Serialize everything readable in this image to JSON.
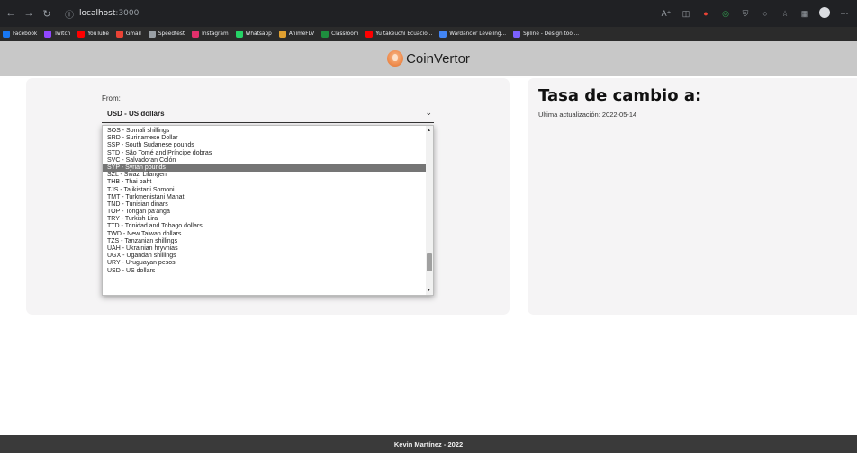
{
  "browser": {
    "url_host": "localhost",
    "url_port": ":3000",
    "bookmarks": [
      {
        "label": "Facebook",
        "color": "#1877f2"
      },
      {
        "label": "Twitch",
        "color": "#9146ff"
      },
      {
        "label": "YouTube",
        "color": "#ff0000"
      },
      {
        "label": "Gmail",
        "color": "#ea4335"
      },
      {
        "label": "Speedtest",
        "color": "#9aa0a6"
      },
      {
        "label": "Instagram",
        "color": "#e1306c"
      },
      {
        "label": "Whatsapp",
        "color": "#25d366"
      },
      {
        "label": "AnimeFLV",
        "color": "#e0a030"
      },
      {
        "label": "Classroom",
        "color": "#1e8e3e"
      },
      {
        "label": "Yu takeuchi Ecuacio...",
        "color": "#ff0000"
      },
      {
        "label": "Wardancer Leveling...",
        "color": "#4285f4"
      },
      {
        "label": "Spline - Design tool...",
        "color": "#7b61ff"
      }
    ]
  },
  "header": {
    "brand": "CoinVertor"
  },
  "converter": {
    "from_label": "From:",
    "selected_value": "USD - US dollars",
    "options": [
      "SOS - Somali shillings",
      "SRD - Surinamese Dollar",
      "SSP - South Sudanese pounds",
      "STD - São Tomé and Príncipe dobras",
      "SVC - Salvadoran Colón",
      "SYP - Syrian pounds",
      "SZL - Swazi Lilangeni",
      "THB - Thai baht",
      "TJS - Tajikistani Somoni",
      "TMT - Turkmenistani Manat",
      "TND - Tunisian dinars",
      "TOP - Tongan pa'anga",
      "TRY - Turkish Lira",
      "TTD - Trinidad and Tobago dollars",
      "TWD - New Taiwan dollars",
      "TZS - Tanzanian shillings",
      "UAH - Ukrainian hryvnias",
      "UGX - Ugandan shillings",
      "URY - Uruguayan pesos",
      "USD - US dollars"
    ],
    "highlighted_index": 5
  },
  "rates": {
    "title": "Tasa de cambio a:",
    "updated": "Ultima actualización: 2022-05-14"
  },
  "footer": {
    "text": "Kevin Martínez - 2022"
  }
}
